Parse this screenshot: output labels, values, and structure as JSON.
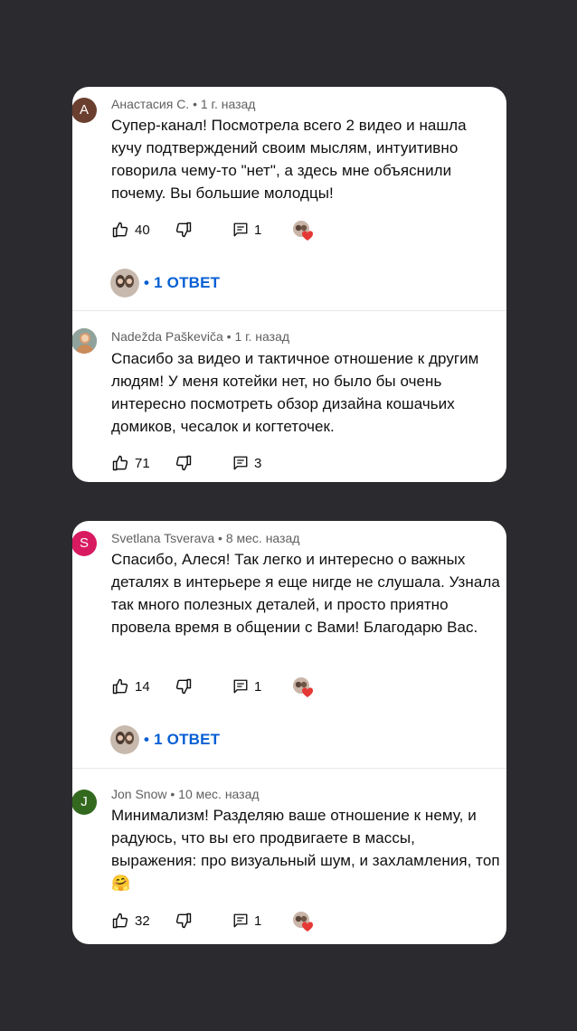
{
  "colors": {
    "background": "#2b2b2f",
    "card": "#ffffff",
    "meta_text": "#606060",
    "reply_link": "#065fd4",
    "avatar_A": "#6a3f2f",
    "avatar_S": "#d81b60",
    "avatar_J": "#33691e",
    "heart": "#e53935"
  },
  "cards": [
    {
      "comments": [
        {
          "avatar_letter": "A",
          "author": "Анастасия С.",
          "time": "1 г. назад",
          "text": "Супер-канал! Посмотрела всего 2 видео и нашла кучу подтверждений своим мыслям, интуитивно говорила чему-то \"нет\", а здесь мне объяснили почему. Вы большие молодцы!",
          "likes": "40",
          "replies_count": "1",
          "creator_heart": true,
          "reply_link": "• 1 ОТВЕТ"
        },
        {
          "avatar_letter": "",
          "author": "Nadežda Paškeviča",
          "time": "1 г. назад",
          "text": "Спасибо за видео и тактичное отношение к другим людям! У меня котейки нет, но было бы очень интересно посмотреть обзор дизайна кошачьих домиков, чесалок и когтеточек.",
          "likes": "71",
          "replies_count": "3",
          "creator_heart": false
        }
      ]
    },
    {
      "comments": [
        {
          "avatar_letter": "S",
          "author": "Svetlana Tsverava",
          "time": "8 мес. назад",
          "text": "Спасибо, Алеся! Так легко и интересно о важных деталях в интерьере я еще нигде не слушала. Узнала так много полезных деталей, и просто приятно провела время в общении с Вами! Благодарю Вас.",
          "likes": "14",
          "replies_count": "1",
          "creator_heart": true,
          "reply_link": "• 1 ОТВЕТ"
        },
        {
          "avatar_letter": "J",
          "author": "Jon Snow",
          "time": "10 мес. назад",
          "text": "Минимализм! Разделяю ваше отношение к нему, и радуюсь, что вы его продвигаете в массы, выражения: про визуальный шум, и захламления, топ🤗",
          "likes": "32",
          "replies_count": "1",
          "creator_heart": true
        }
      ]
    }
  ],
  "separator": " • "
}
